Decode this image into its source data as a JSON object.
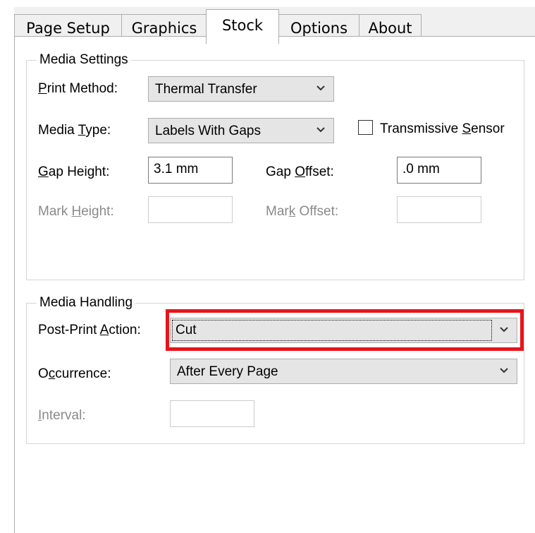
{
  "tabs": [
    {
      "label": "Page Setup"
    },
    {
      "label": "Graphics"
    },
    {
      "label": "Stock"
    },
    {
      "label": "Options"
    },
    {
      "label": "About"
    }
  ],
  "active_tab": "Stock",
  "media_settings": {
    "title": "Media Settings",
    "print_method": {
      "label_pre": "",
      "label_key": "P",
      "label_post": "rint Method:",
      "value": "Thermal Transfer"
    },
    "media_type": {
      "label_pre": "Media ",
      "label_key": "T",
      "label_post": "ype:",
      "value": "Labels With Gaps"
    },
    "transmissive_sensor": {
      "label_pre": "Transmissive ",
      "label_key": "S",
      "label_post": "ensor",
      "checked": false
    },
    "gap_height": {
      "label_pre": "",
      "label_key": "G",
      "label_post": "ap Height:",
      "value": "3.1 mm"
    },
    "gap_offset": {
      "label_pre": "Gap ",
      "label_key": "O",
      "label_post": "ffset:",
      "value": ".0 mm"
    },
    "mark_height": {
      "label_pre": "Mark ",
      "label_key": "H",
      "label_post": "eight:",
      "value": ""
    },
    "mark_offset": {
      "label_pre": "Mar",
      "label_key": "k",
      "label_post": " Offset:",
      "value": ""
    }
  },
  "media_handling": {
    "title": "Media Handling",
    "post_print_action": {
      "label_pre": "Post-Print ",
      "label_key": "A",
      "label_post": "ction:",
      "value": "Cut"
    },
    "occurrence": {
      "label_pre": "O",
      "label_key": "c",
      "label_post": "currence:",
      "value": "After Every Page"
    },
    "interval": {
      "label_pre": "",
      "label_key": "I",
      "label_post": "nterval:",
      "value": ""
    }
  },
  "colors": {
    "highlight": "#e8141b"
  },
  "icons": {
    "dropdown": "chevron-down-icon"
  }
}
